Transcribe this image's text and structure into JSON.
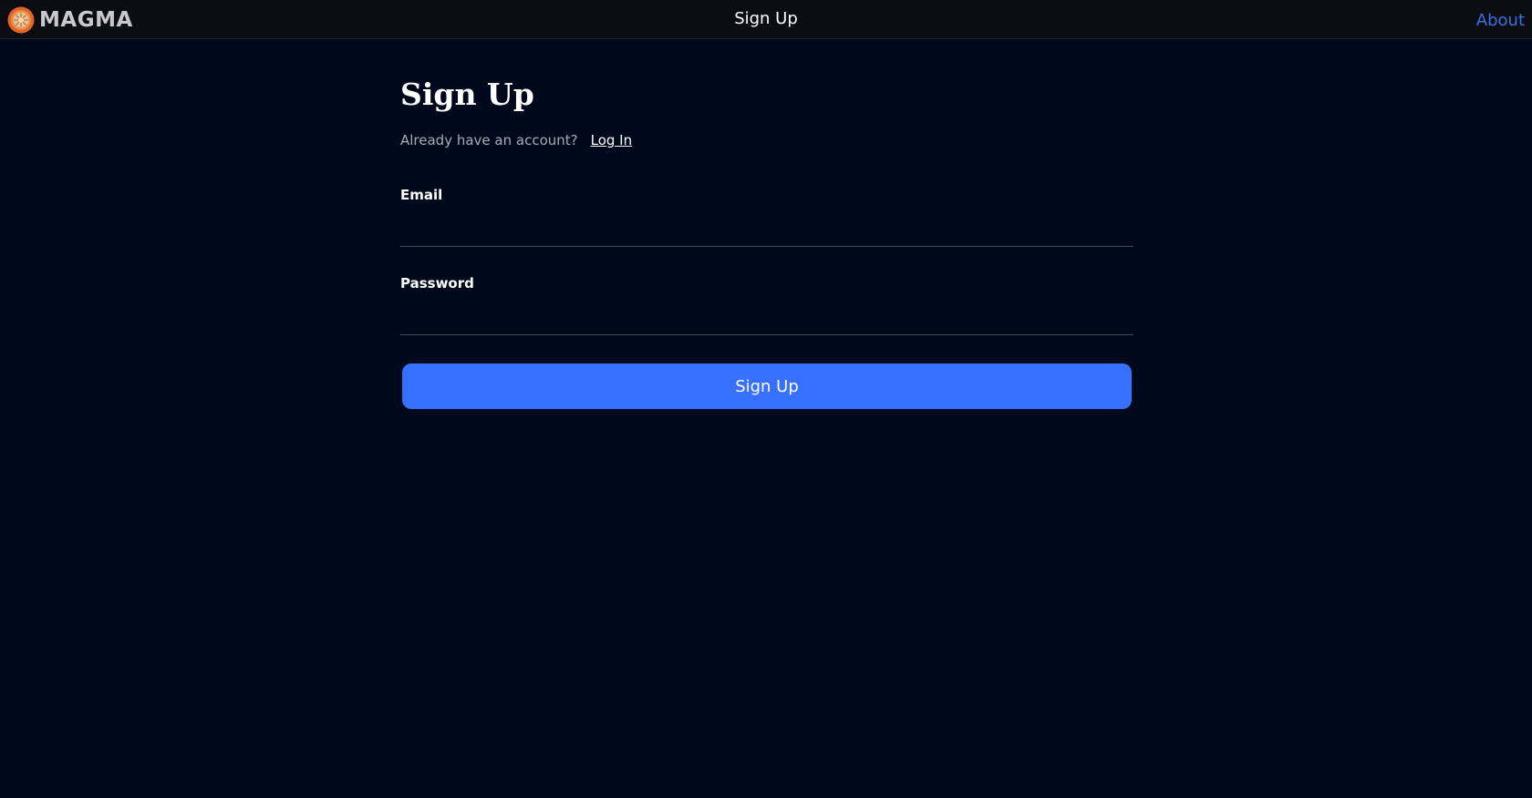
{
  "header": {
    "brand_name": "MAGMA",
    "logo_icon": "magma-sun-logo",
    "title": "Sign Up",
    "about_link": "About"
  },
  "form": {
    "heading": "Sign Up",
    "account_prompt": "Already have an account?",
    "login_link": "Log In",
    "email_label": "Email",
    "email_value": "",
    "password_label": "Password",
    "password_value": "",
    "submit_label": "Sign Up"
  },
  "colors": {
    "page_background": "#00091c",
    "topbar_background": "#0b0d13",
    "accent_button": "#3770ff",
    "about_link": "#3b6fe0",
    "logo_orange": "#e0642a"
  }
}
